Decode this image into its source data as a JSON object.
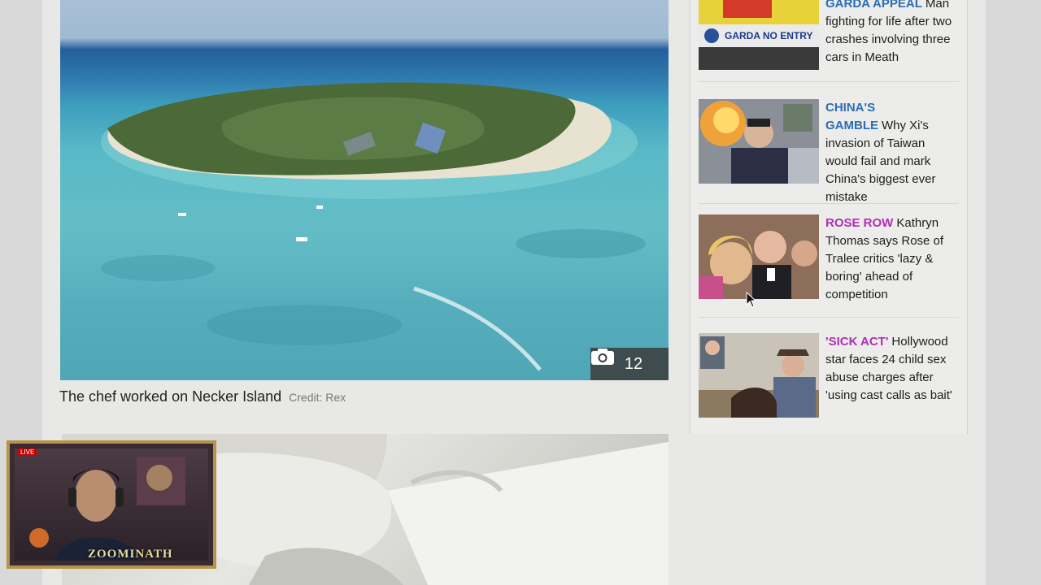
{
  "main_article": {
    "photo_count": "12",
    "caption": "The chef worked on Necker Island",
    "credit": "Credit: Rex"
  },
  "sidebar": {
    "stories": [
      {
        "kicker": "GARDA APPEAL",
        "headline": "Man fighting for life after two crashes involving three cars in Meath",
        "kicker_color": "#2a6db5",
        "thumb_text": "GARDA NO ENTRY"
      },
      {
        "kicker": "CHINA'S GAMBLE",
        "headline": "Why Xi's invasion of Taiwan would fail and mark China's biggest ever mistake",
        "kicker_color": "#2a6db5"
      },
      {
        "kicker": "ROSE ROW",
        "headline": "Kathryn Thomas says Rose of Tralee critics 'lazy & boring' ahead of competition",
        "kicker_color": "#b02fb5"
      },
      {
        "kicker": "'SICK ACT'",
        "headline": "Hollywood star faces 24 child sex abuse charges after 'using cast calls as bait'",
        "kicker_color": "#b02fb5"
      }
    ]
  },
  "webcam": {
    "brand": "ZOOMINATH",
    "live_label": "LIVE"
  }
}
